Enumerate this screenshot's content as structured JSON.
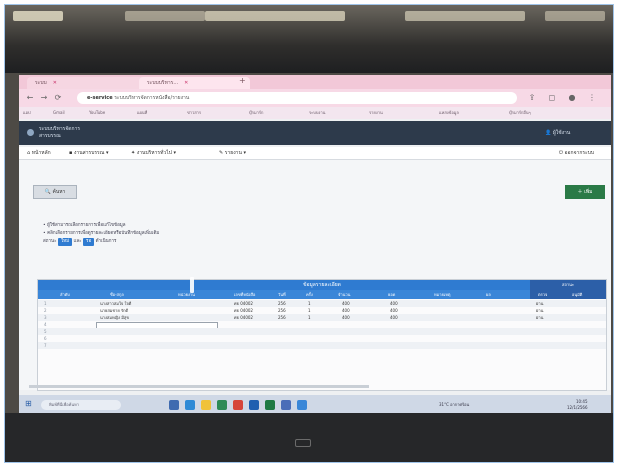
{
  "browser": {
    "tabs": [
      {
        "label": "ระบบ",
        "active": false
      },
      {
        "label": "ระบบบริหาร...",
        "active": true
      }
    ],
    "url_prefix": "e-service",
    "url_rest": "ระบบบริหารจัดการหนังสือ/รายงาน",
    "bookmarks": [
      "แอป",
      "Gmail",
      "YouTube",
      "แผนที่",
      "ข่าวสาร",
      "บุ๊กมาร์ก",
      "ระบบงาน",
      "รายงาน",
      "แหล่งข้อมูล",
      "บุ๊กมาร์กอื่นๆ"
    ]
  },
  "app": {
    "brand_line1": "ระบบบริหารจัดการ",
    "brand_line2": "สารบรรณ",
    "user_label": "ผู้ใช้งาน"
  },
  "menu": {
    "items": [
      "หน้าหลัก",
      "งานสารบรรณ",
      "งานบริหารทั่วไป",
      "รายงาน"
    ],
    "right_item": "ออกจากระบบ"
  },
  "toolbar": {
    "search_label": "ค้นหา",
    "add_label": "เพิ่ม"
  },
  "notes": {
    "line1": "ผู้ใช้สามารถเลือกรายการเพื่อแก้ไขข้อมูล",
    "line2": "คลิกเลือกรายการเพื่อดูรายละเอียดหรือบันทึกข้อมูลเพิ่มเติม",
    "line3_prefix": "สถานะ",
    "badge1": "ใหม่",
    "line3_mid": "และ",
    "badge2": "รอ",
    "line3_suffix": "ดำเนินการ"
  },
  "table": {
    "group_header": "ข้อมูลรายละเอียด",
    "right_group_header": "สถานะ",
    "columns": [
      "ลำดับ",
      "ชื่อ-สกุล",
      "หน่วยงาน",
      "เลขที่หนังสือ",
      "วันที่",
      "ครั้ง",
      "จำนวน",
      "ยอด",
      "หมายเหตุ",
      "ผล",
      "ตรวจ",
      "อนุมัติ"
    ],
    "rows": [
      {
        "no": "1",
        "name": "นางสาวสมใจ ใจดี",
        "code": "ศธ 04002",
        "date": "256",
        "count": "1",
        "amount": "400",
        "total": "400",
        "status": "ผ่าน"
      },
      {
        "no": "2",
        "name": "นายสมชาย รักดี",
        "code": "ศธ 04002",
        "date": "256",
        "count": "1",
        "amount": "400",
        "total": "400",
        "status": "ผ่าน"
      },
      {
        "no": "3",
        "name": "นางสมหญิง มีสุข",
        "code": "ศธ 04002",
        "date": "256",
        "count": "1",
        "amount": "400",
        "total": "400",
        "status": "ผ่าน"
      },
      {
        "no": "4",
        "name": "",
        "code": "",
        "date": "",
        "count": "",
        "amount": "",
        "total": "",
        "status": ""
      },
      {
        "no": "5",
        "name": "",
        "code": "",
        "date": "",
        "count": "",
        "amount": "",
        "total": "",
        "status": ""
      },
      {
        "no": "6",
        "name": "",
        "code": "",
        "date": "",
        "count": "",
        "amount": "",
        "total": "",
        "status": ""
      },
      {
        "no": "7",
        "name": "",
        "code": "",
        "date": "",
        "count": "",
        "amount": "",
        "total": "",
        "status": ""
      }
    ]
  },
  "taskbar": {
    "search_placeholder": "พิมพ์ที่นี่เพื่อค้นหา",
    "weather": "31°C อากาศร้อน",
    "time": "10:45",
    "date": "12/1/2566"
  },
  "colors": {
    "accent": "#2f7bd1",
    "header": "#2d3a4b",
    "success": "#2a7a47",
    "tabbar": "#f2c8d8"
  }
}
